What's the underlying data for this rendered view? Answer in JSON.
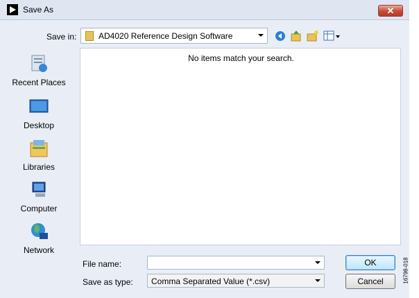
{
  "window": {
    "title": "Save As",
    "close_glyph": "✕"
  },
  "toolbar": {
    "save_in_label": "Save in:",
    "save_in_underline": "i",
    "location": "AD4020 Reference Design Software",
    "tools": [
      "back-icon",
      "up-folder-icon",
      "new-folder-icon",
      "views-menu-icon"
    ]
  },
  "places": [
    {
      "label": "Recent Places",
      "icon": "recent-places-icon"
    },
    {
      "label": "Desktop",
      "icon": "desktop-icon"
    },
    {
      "label": "Libraries",
      "icon": "libraries-icon"
    },
    {
      "label": "Computer",
      "icon": "computer-icon"
    },
    {
      "label": "Network",
      "icon": "network-icon"
    }
  ],
  "file_list": {
    "empty_message": "No items match your search."
  },
  "form": {
    "file_name_label": "File name:",
    "file_name_value": "",
    "save_type_label": "Save as type:",
    "save_type_value": "Comma Separated Value (*.csv)"
  },
  "buttons": {
    "ok": "OK",
    "cancel": "Cancel"
  },
  "side_code": "16798-018",
  "colors": {
    "titlebar": "#dfe6f2",
    "close": "#c74a36",
    "body": "#e9eef6"
  }
}
